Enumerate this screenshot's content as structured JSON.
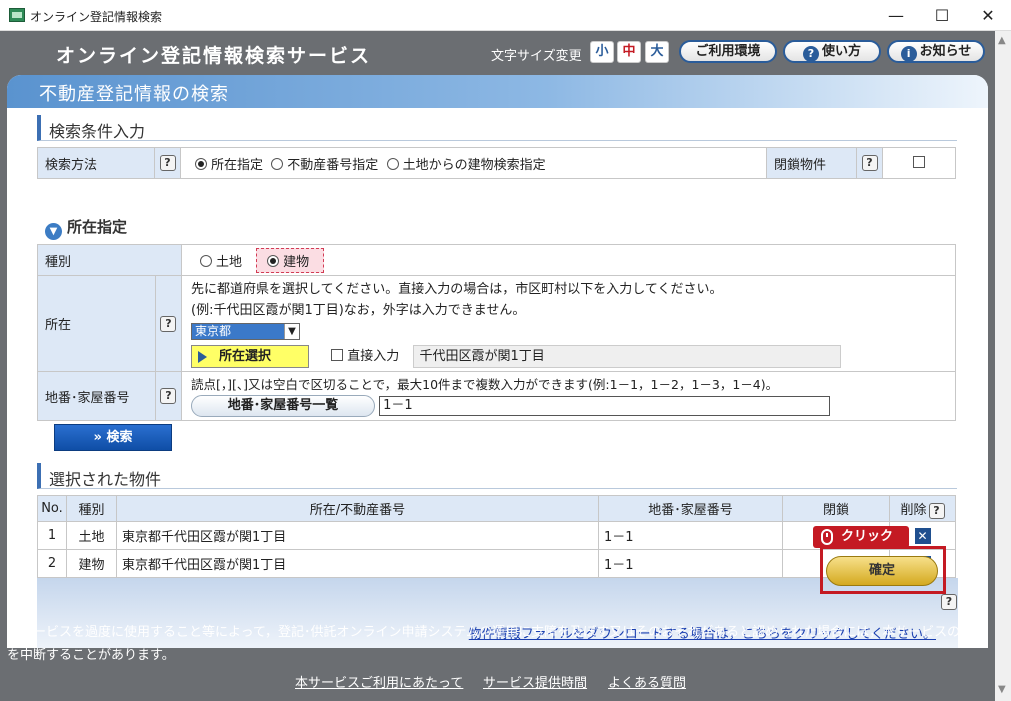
{
  "window": {
    "title": "オンライン登記情報検索",
    "minimize": "—",
    "maximize": "☐",
    "close": "✕"
  },
  "header": {
    "service_title": "オンライン登記情報検索サービス",
    "font_size_label": "文字サイズ変更",
    "font_small": "小",
    "font_medium": "中",
    "font_large": "大",
    "env_button": "ご利用環境",
    "howto_button": "使い方",
    "notice_button": "お知らせ"
  },
  "page_band": "不動産登記情報の検索",
  "criteria": {
    "section_title": "検索条件入力",
    "method_label": "検索方法",
    "method_options": [
      "所在指定",
      "不動産番号指定",
      "土地からの建物検索指定"
    ],
    "method_selected": "所在指定",
    "closed_label": "閉鎖物件",
    "help": "?"
  },
  "location": {
    "subhead": "所在指定",
    "type_label": "種別",
    "type_options": [
      "土地",
      "建物"
    ],
    "type_selected": "建物",
    "address_label": "所在",
    "address_hint1": "先に都道府県を選択してください。直接入力の場合は，市区町村以下を入力してください。",
    "address_hint2": "(例:千代田区霞が関1丁目)なお，外字は入力できません。",
    "prefecture_value": "東京都",
    "select_button": "所在選択",
    "direct_input_label": "直接入力",
    "address_value": "千代田区霞が関1丁目",
    "lot_label": "地番･家屋番号",
    "lot_hint": "読点[，][、]又は空白で区切ることで，最大10件まで複数入力ができます(例:1－1，1－2，1－3，1－4)。",
    "lot_list_button": "地番･家屋番号一覧",
    "lot_value": "1－1"
  },
  "search_button": "» 検索",
  "selected": {
    "section_title": "選択された物件",
    "columns": [
      "No.",
      "種別",
      "所在/不動産番号",
      "地番･家屋番号",
      "閉鎖",
      "削除"
    ],
    "rows": [
      {
        "no": "1",
        "type": "土地",
        "address": "東京都千代田区霞が関1丁目",
        "lot": "1－1",
        "closed": "－"
      },
      {
        "no": "2",
        "type": "建物",
        "address": "東京都千代田区霞が関1丁目",
        "lot": "1－1",
        "closed": ""
      }
    ],
    "delete_icon": "✕"
  },
  "click_tag": "クリック",
  "confirm_button": "確定",
  "download_link": "物件情報ファイルをダウンロードする場合は，こちらをクリックしてください。",
  "notice_text": "本サービスを過度に使用すること等によって，登記･供託オンライン申請システムの運用に支障を及ぼす又はそのおそれがあると認められた場合には，本サービスの使用を中断することがあります。",
  "footer_links": [
    "本サービスご利用にあたって",
    "サービス提供時間",
    "よくある質問"
  ]
}
